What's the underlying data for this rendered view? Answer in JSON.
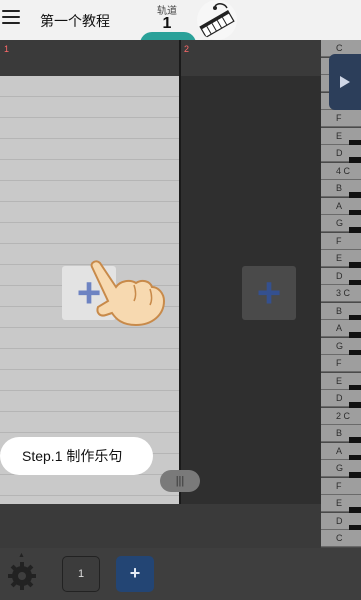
{
  "header": {
    "title": "第一个教程",
    "track_label": "轨道",
    "track_number": "1",
    "instrument_icon": "piano-keyboard-icon"
  },
  "editor": {
    "marker_1": "1",
    "marker_2": "2",
    "scroll_handle_text": "|||"
  },
  "tutorial": {
    "step_text": "Step.1 制作乐句",
    "pointer_icon": "pointing-hand-icon"
  },
  "piano": {
    "keys": [
      "C",
      "B",
      "A",
      "G",
      "F",
      "E",
      "D",
      "4 C",
      "B",
      "A",
      "G",
      "F",
      "E",
      "D",
      "3 C",
      "B",
      "A",
      "G",
      "F",
      "E",
      "D",
      "2 C",
      "B",
      "A",
      "G",
      "F",
      "E",
      "D",
      "C"
    ],
    "play_icon": "play-icon"
  },
  "footer": {
    "page_number": "1",
    "add_page_label": "+",
    "settings_icon": "gear-icon"
  },
  "colors": {
    "accent_teal": "#2aa199",
    "button_blue": "#234574",
    "plus_blue": "#6d83c2"
  }
}
